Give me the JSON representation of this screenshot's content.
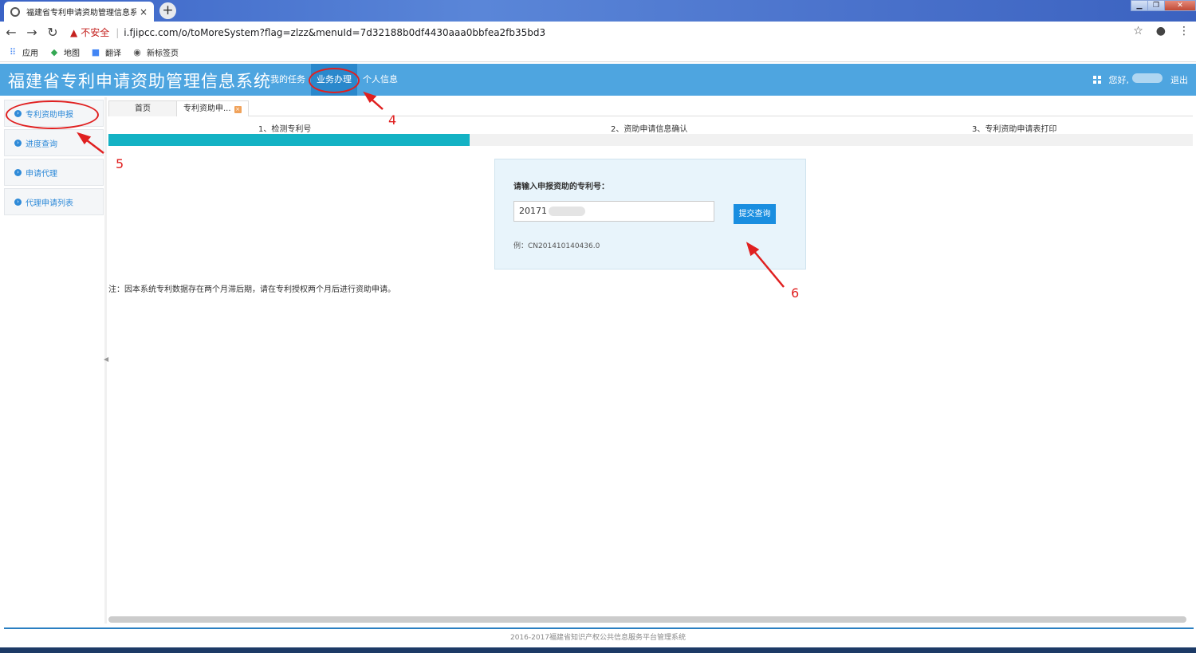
{
  "browser": {
    "tab_title": "福建省专利申请资助管理信息系统",
    "tab_close": "×",
    "new_tab": "+",
    "window_controls": [
      "▁",
      "❐",
      "✕"
    ],
    "insecure_label": "不安全",
    "url": "i.fjipcc.com/o/toMoreSystem?flag=zlzz&menuId=7d32188b0df4430aaa0bbfea2fb35bd3",
    "bookmarks": [
      {
        "label": "应用",
        "icon": "apps-icon"
      },
      {
        "label": "地图",
        "icon": "maps-icon"
      },
      {
        "label": "翻译",
        "icon": "translate-icon"
      },
      {
        "label": "新标签页",
        "icon": "globe-icon"
      }
    ]
  },
  "header": {
    "title": "福建省专利申请资助管理信息系统",
    "nav": [
      "我的任务",
      "业务办理",
      "个人信息"
    ],
    "active_nav": "业务办理",
    "greeting": "您好,",
    "logout": "退出"
  },
  "sidebar": {
    "items": [
      {
        "label": "专利资助申报"
      },
      {
        "label": "进度查询"
      },
      {
        "label": "申请代理"
      },
      {
        "label": "代理申请列表"
      }
    ]
  },
  "main": {
    "tabs": [
      {
        "label": "首页"
      },
      {
        "label": "专利资助申..."
      }
    ],
    "steps": [
      "1、检测专利号",
      "2、资助申请信息确认",
      "3、专利资助申请表打印"
    ],
    "progress": 0.333,
    "form": {
      "label": "请输入申报资助的专利号：",
      "input_value": "20171",
      "submit": "提交查询",
      "example": "例：CN201410140436.0"
    },
    "note": "注：因本系统专利数据存在两个月滞后期，请在专利授权两个月后进行资助申请。"
  },
  "annotations": [
    "4",
    "5",
    "6"
  ],
  "footer": "2016-2017福建省知识产权公共信息服务平台管理系统",
  "colors": {
    "header": "#4ea5e0",
    "progress": "#14b2c4",
    "button": "#1a8ee0",
    "annotation": "#e02020"
  }
}
